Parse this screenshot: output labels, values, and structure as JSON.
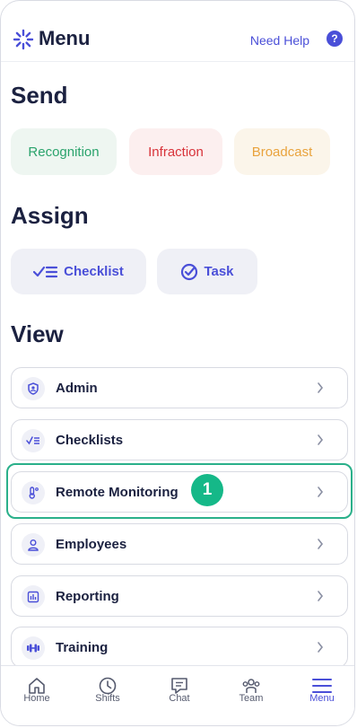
{
  "header": {
    "title": "Menu",
    "help_label": "Need Help",
    "help_icon": "?"
  },
  "send": {
    "heading": "Send",
    "items": [
      {
        "label": "Recognition",
        "color": "#2aa36c"
      },
      {
        "label": "Infraction",
        "color": "#d8333a"
      },
      {
        "label": "Broadcast",
        "color": "#e9a33d"
      }
    ]
  },
  "assign": {
    "heading": "Assign",
    "items": [
      {
        "label": "Checklist",
        "icon": "checklist-icon"
      },
      {
        "label": "Task",
        "icon": "check-circle-icon"
      }
    ]
  },
  "view": {
    "heading": "View",
    "items": [
      {
        "label": "Admin",
        "icon": "shield-user-icon"
      },
      {
        "label": "Checklists",
        "icon": "checklist-icon"
      },
      {
        "label": "Remote Monitoring",
        "icon": "thermometer-icon"
      },
      {
        "label": "Employees",
        "icon": "person-icon"
      },
      {
        "label": "Reporting",
        "icon": "report-icon"
      },
      {
        "label": "Training",
        "icon": "dumbbell-icon"
      }
    ]
  },
  "annotation": {
    "step": "1"
  },
  "tabbar": {
    "items": [
      {
        "label": "Home",
        "icon": "home-icon"
      },
      {
        "label": "Shifts",
        "icon": "clock-icon"
      },
      {
        "label": "Chat",
        "icon": "chat-icon"
      },
      {
        "label": "Team",
        "icon": "team-icon"
      },
      {
        "label": "Menu",
        "icon": "hamburger-icon",
        "active": true
      }
    ]
  },
  "colors": {
    "accent": "#4a4fd8",
    "highlight": "#2ab08a",
    "badge": "#15b888",
    "text": "#1b2140"
  }
}
